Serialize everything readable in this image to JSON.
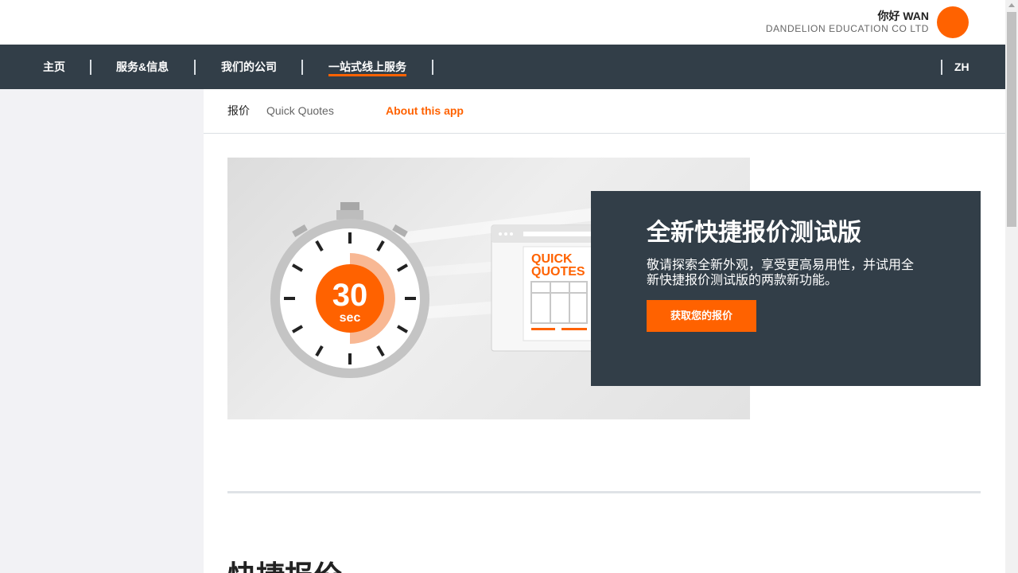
{
  "header": {
    "greeting": "你好 WAN",
    "company": "DANDELION EDUCATION CO LTD",
    "avatar_color": "#ff6200"
  },
  "nav": {
    "items": [
      {
        "label": "主页"
      },
      {
        "label": "服务&信息"
      },
      {
        "label": "我们的公司"
      },
      {
        "label": "一站式线上服务",
        "active": true
      }
    ],
    "lang": "ZH",
    "bg_color": "#323e48"
  },
  "subnav": {
    "items": [
      "报价",
      "Quick Quotes",
      "About this app"
    ]
  },
  "hero": {
    "image": {
      "timer_number": "30",
      "timer_unit": "sec",
      "card_line1": "QUICK",
      "card_line2": "QUOTES"
    },
    "title": "全新快捷报价测试版",
    "description": "敬请探索全新外观，享受更高易用性，并试用全新快捷报价测试版的两款新功能。",
    "button_label": "获取您的报价",
    "panel_color": "#323e48",
    "accent_color": "#ff6200"
  },
  "section": {
    "title": "快捷报价"
  }
}
